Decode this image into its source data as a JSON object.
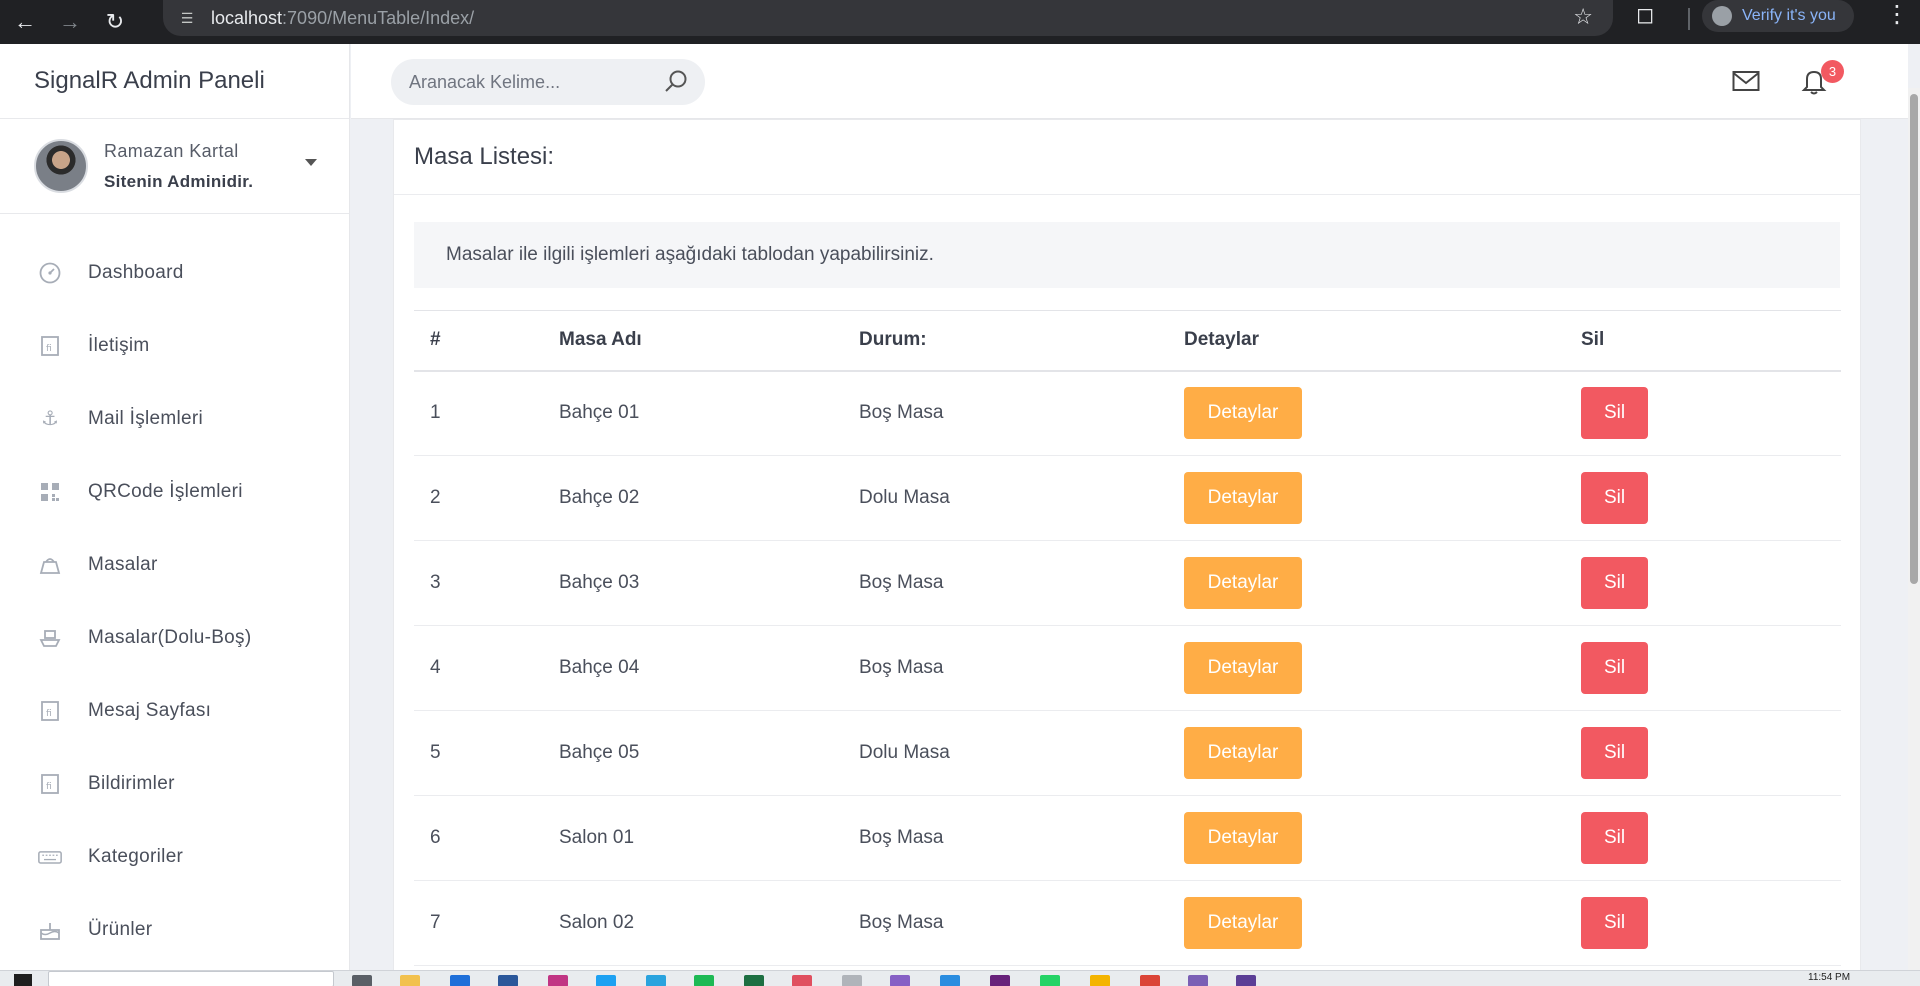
{
  "browser": {
    "url_host": "localhost",
    "url_rest": ":7090/MenuTable/Index/",
    "verify_label": "Verify it's you"
  },
  "sidebar": {
    "brand": "SignalR Admin Paneli",
    "user": {
      "name": "Ramazan Kartal",
      "role": "Sitenin Adminidir."
    },
    "items": [
      {
        "label": "Dashboard",
        "icon": "gauge-icon"
      },
      {
        "label": "İletişim",
        "icon": "document-icon"
      },
      {
        "label": "Mail İşlemleri",
        "icon": "anchor-icon"
      },
      {
        "label": "QRCode İşlemleri",
        "icon": "qrcode-icon"
      },
      {
        "label": "Masalar",
        "icon": "table-icon"
      },
      {
        "label": "Masalar(Dolu-Boş)",
        "icon": "ship-icon"
      },
      {
        "label": "Mesaj Sayfası",
        "icon": "document-icon"
      },
      {
        "label": "Bildirimler",
        "icon": "document-icon"
      },
      {
        "label": "Kategoriler",
        "icon": "keyboard-icon"
      },
      {
        "label": "Ürünler",
        "icon": "cake-icon"
      }
    ]
  },
  "header": {
    "search_placeholder": "Aranacak Kelime...",
    "notification_count": "3"
  },
  "content": {
    "title": "Masa Listesi:",
    "info": "Masalar ile ilgili işlemleri aşağıdaki tablodan yapabilirsiniz.",
    "columns": [
      "#",
      "Masa Adı",
      "Durum:",
      "Detaylar",
      "Sil"
    ],
    "rows": [
      {
        "id": "1",
        "name": "Bahçe 01",
        "status": "Boş Masa",
        "detail": "Detaylar",
        "delete": "Sil"
      },
      {
        "id": "2",
        "name": "Bahçe 02",
        "status": "Dolu Masa",
        "detail": "Detaylar",
        "delete": "Sil"
      },
      {
        "id": "3",
        "name": "Bahçe 03",
        "status": "Boş Masa",
        "detail": "Detaylar",
        "delete": "Sil"
      },
      {
        "id": "4",
        "name": "Bahçe 04",
        "status": "Boş Masa",
        "detail": "Detaylar",
        "delete": "Sil"
      },
      {
        "id": "5",
        "name": "Bahçe 05",
        "status": "Dolu Masa",
        "detail": "Detaylar",
        "delete": "Sil"
      },
      {
        "id": "6",
        "name": "Salon 01",
        "status": "Boş Masa",
        "detail": "Detaylar",
        "delete": "Sil"
      },
      {
        "id": "7",
        "name": "Salon 02",
        "status": "Boş Masa",
        "detail": "Detaylar",
        "delete": "Sil"
      }
    ]
  },
  "taskbar": {
    "clock": "11:54 PM"
  },
  "colors": {
    "warning": "#ffad46",
    "danger": "#f25961",
    "badge": "#f25961"
  }
}
